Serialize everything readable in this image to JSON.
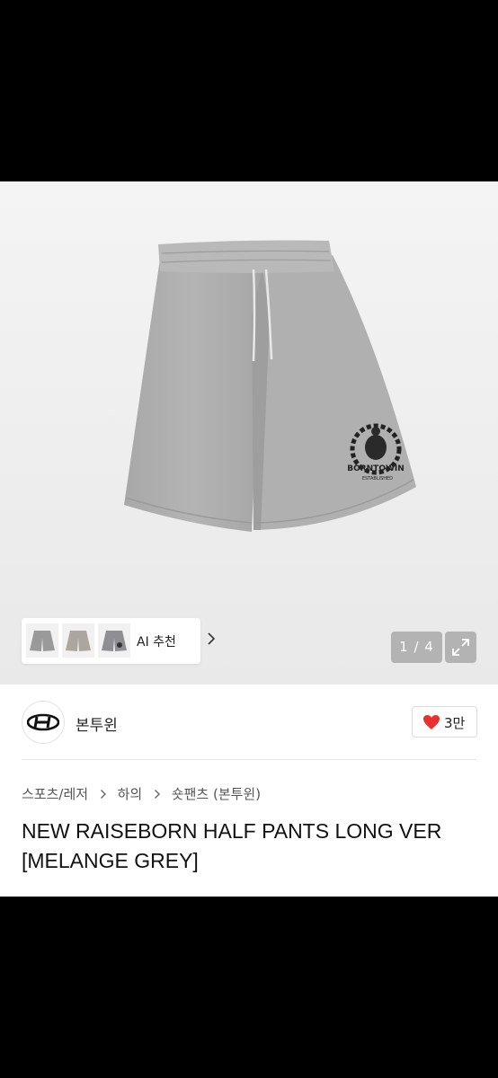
{
  "product": {
    "image_counter": "1 / 4",
    "ai_recommend_label": "AI 추천",
    "shorts_logo_text": "BORNTOWIN",
    "shorts_logo_subtext": "ESTABLISHED"
  },
  "seller": {
    "brand_name": "본투윈",
    "like_count": "3만"
  },
  "breadcrumb": {
    "items": [
      "스포츠/레저",
      "하의",
      "숏팬츠 (본투윈)"
    ]
  },
  "title": {
    "line1": "NEW RAISEBORN HALF PANTS LONG VER",
    "line2": "[MELANGE GREY]"
  },
  "colors": {
    "heart": "#e8302e",
    "shorts_grey": "#a9a9a9"
  }
}
